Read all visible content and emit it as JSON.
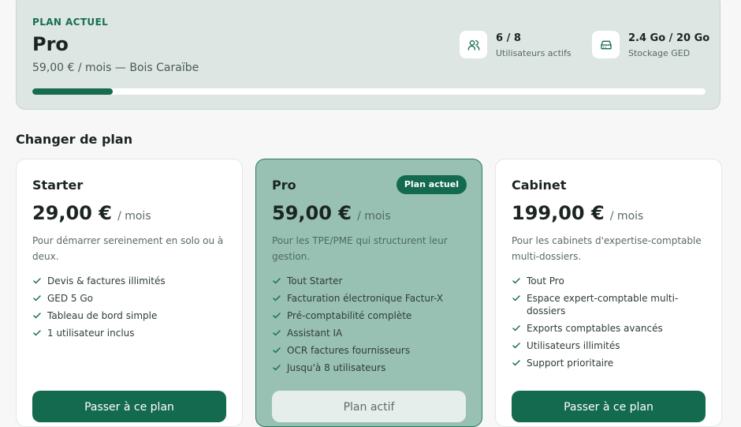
{
  "current_plan": {
    "kicker": "PLAN ACTUEL",
    "name": "Pro",
    "price_line": "59,00 € / mois — Bois Caraïbe",
    "usage_percent": 12,
    "stats": [
      {
        "icon": "users-icon",
        "value": "6 / 8",
        "label": "Utilisateurs actifs"
      },
      {
        "icon": "hard-drive-icon",
        "value": "2.4 Go / 20 Go",
        "label": "Stockage GED"
      }
    ]
  },
  "section_title": "Changer de plan",
  "plans": [
    {
      "name": "Starter",
      "amount": "29,00 €",
      "period": "/ mois",
      "description": "Pour démarrer sereinement en solo ou à deux.",
      "features": [
        "Devis & factures illimités",
        "GED 5 Go",
        "Tableau de bord simple",
        "1 utilisateur inclus"
      ],
      "button": "Passer à ce plan"
    },
    {
      "name": "Pro",
      "badge": "Plan actuel",
      "amount": "59,00 €",
      "period": "/ mois",
      "description": "Pour les TPE/PME qui structurent leur gestion.",
      "features": [
        "Tout Starter",
        "Facturation électronique Factur-X",
        "Pré-comptabilité complète",
        "Assistant IA",
        "OCR factures fournisseurs",
        "Jusqu'à 8 utilisateurs"
      ],
      "button": "Plan actif"
    },
    {
      "name": "Cabinet",
      "amount": "199,00 €",
      "period": "/ mois",
      "description": "Pour les cabinets d'expertise-comptable multi-dossiers.",
      "features": [
        "Tout Pro",
        "Espace expert-comptable multi-dossiers",
        "Exports comptables avancés",
        "Utilisateurs illimités",
        "Support prioritaire"
      ],
      "button": "Passer à ce plan"
    }
  ],
  "colors": {
    "accent": "#136a4e",
    "active_card": "#98c1b3",
    "summary_bg": "#dde6e2"
  }
}
